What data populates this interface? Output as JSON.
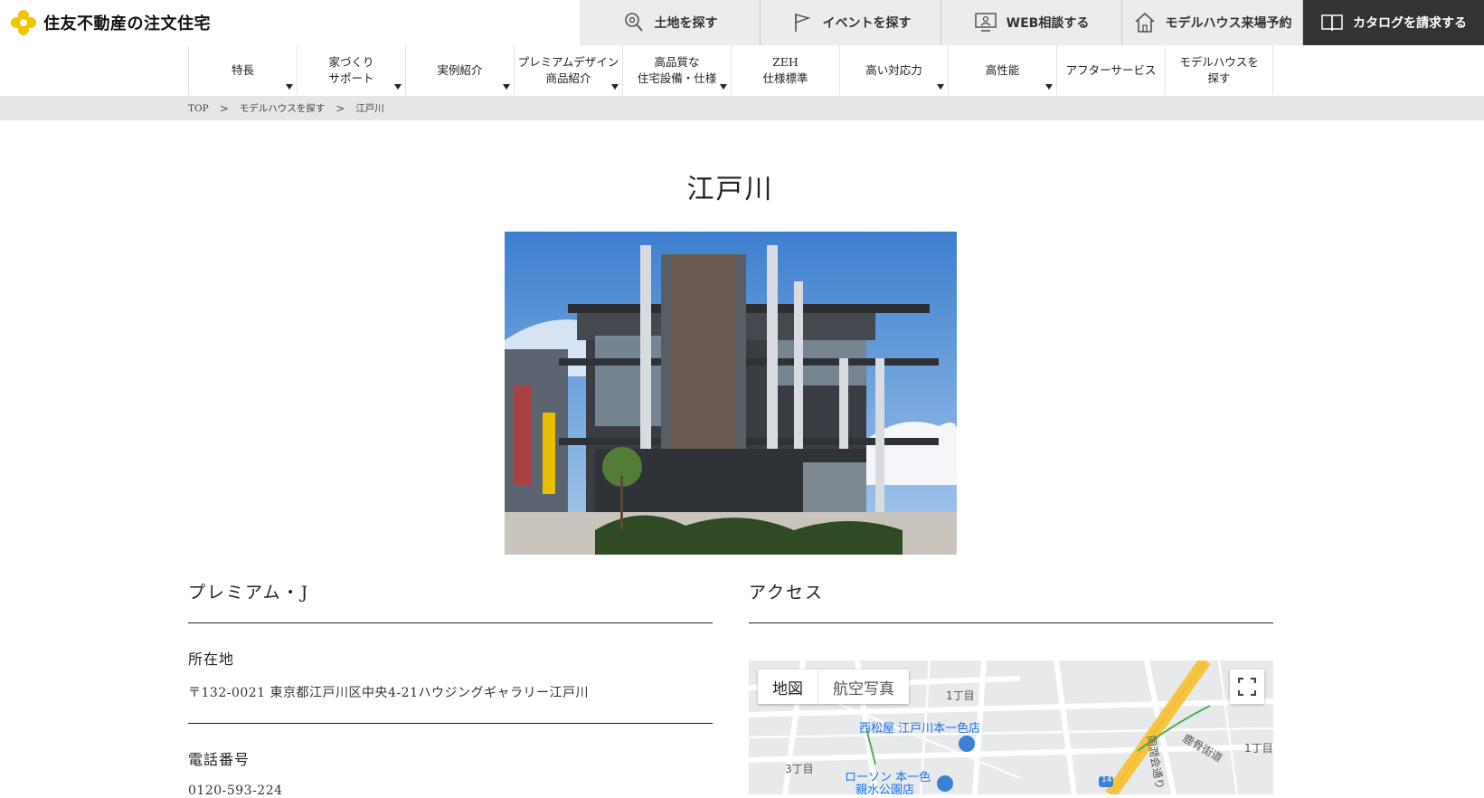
{
  "brand": {
    "name": "住友不動産の注文住宅"
  },
  "toplinks": [
    {
      "label": "土地を探す",
      "icon": "map-pin-search-icon"
    },
    {
      "label": "イベントを探す",
      "icon": "flag-icon"
    },
    {
      "label": "WEB相談する",
      "icon": "monitor-person-icon"
    },
    {
      "label": "モデルハウス来場予約",
      "icon": "house-icon"
    },
    {
      "label": "カタログを請求する",
      "icon": "book-icon"
    }
  ],
  "nav": [
    {
      "label": "特長"
    },
    {
      "label": "家づくり\nサポート"
    },
    {
      "label": "実例紹介"
    },
    {
      "label": "プレミアムデザイン\n商品紹介"
    },
    {
      "label": "高品質な\n住宅設備・仕様"
    },
    {
      "label": "ZEH\n仕様標準"
    },
    {
      "label": "高い対応力"
    },
    {
      "label": "高性能"
    },
    {
      "label": "アフターサービス"
    },
    {
      "label": "モデルハウスを\n探す"
    }
  ],
  "breadcrumb": [
    "TOP",
    "モデルハウスを探す",
    "江戸川"
  ],
  "page": {
    "title": "江戸川"
  },
  "model": {
    "name": "プレミアム・J",
    "address_label": "所在地",
    "address": "〒132-0021 東京都江戸川区中央4-21ハウジングギャラリー江戸川",
    "phone_label": "電話番号",
    "phone": "0120-593-224"
  },
  "access": {
    "heading": "アクセス",
    "map_tabs": [
      "地図",
      "航空写真"
    ],
    "labels": {
      "store": "西松屋 江戸川本一色店",
      "lawson": "ローソン 本一色",
      "lawson2": "親水公園店",
      "chome1": "1丁目",
      "chome1b": "1丁目",
      "chome3": "3丁目",
      "road1": "鹿骨街道",
      "road2": "同潤会通り",
      "route": "14"
    }
  }
}
